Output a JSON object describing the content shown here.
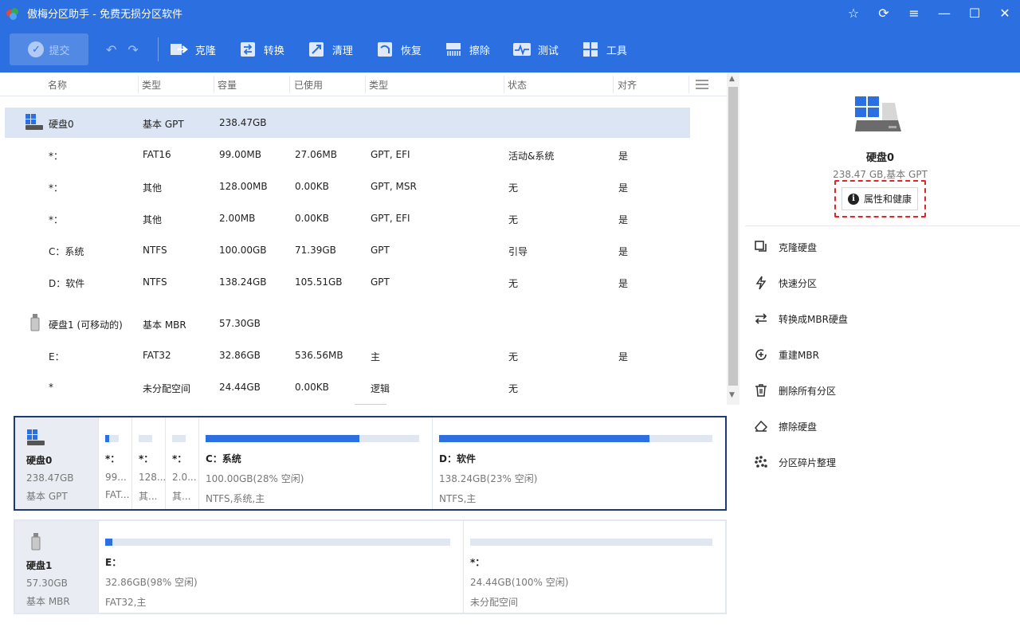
{
  "window": {
    "title": "傲梅分区助手 - 免费无损分区软件",
    "controls": [
      "star-icon",
      "refresh-icon",
      "menu-icon",
      "minimize-icon",
      "maximize-icon",
      "close-icon"
    ]
  },
  "toolbar": {
    "commit_label": "提交",
    "items": [
      {
        "label": "克隆",
        "icon": "clone-icon"
      },
      {
        "label": "转换",
        "icon": "convert-icon"
      },
      {
        "label": "清理",
        "icon": "cleanup-icon"
      },
      {
        "label": "恢复",
        "icon": "recover-icon"
      },
      {
        "label": "擦除",
        "icon": "wipe-icon"
      },
      {
        "label": "测试",
        "icon": "test-icon"
      },
      {
        "label": "工具",
        "icon": "tools-icon"
      }
    ]
  },
  "table": {
    "columns": [
      "名称",
      "类型",
      "容量",
      "已使用",
      "类型",
      "状态",
      "对齐"
    ],
    "rows": [
      {
        "name": "硬盘0",
        "type": "基本 GPT",
        "capacity": "238.47GB",
        "used": "",
        "ptype": "",
        "status": "",
        "align": "",
        "kind": "disk",
        "selected": true
      },
      {
        "name": "*：",
        "type": "FAT16",
        "capacity": "99.00MB",
        "used": "27.06MB",
        "ptype": "GPT, EFI",
        "status": "活动&系统",
        "align": "是"
      },
      {
        "name": "*：",
        "type": "其他",
        "capacity": "128.00MB",
        "used": "0.00KB",
        "ptype": "GPT, MSR",
        "status": "无",
        "align": "是"
      },
      {
        "name": "*：",
        "type": "其他",
        "capacity": "2.00MB",
        "used": "0.00KB",
        "ptype": "GPT, EFI",
        "status": "无",
        "align": "是"
      },
      {
        "name": "C：系统",
        "type": "NTFS",
        "capacity": "100.00GB",
        "used": "71.39GB",
        "ptype": "GPT",
        "status": "引导",
        "align": "是"
      },
      {
        "name": "D：软件",
        "type": "NTFS",
        "capacity": "138.24GB",
        "used": "105.51GB",
        "ptype": "GPT",
        "status": "无",
        "align": "是"
      },
      {
        "name": "硬盘1 (可移动的)",
        "type": "基本 MBR",
        "capacity": "57.30GB",
        "used": "",
        "ptype": "",
        "status": "",
        "align": "",
        "kind": "usb"
      },
      {
        "name": "E：",
        "type": "FAT32",
        "capacity": "32.86GB",
        "used": "536.56MB",
        "ptype": "主",
        "status": "无",
        "align": "是"
      },
      {
        "name": "*",
        "type": "未分配空间",
        "capacity": "24.44GB",
        "used": "0.00KB",
        "ptype": "逻辑",
        "status": "无",
        "align": ""
      }
    ]
  },
  "diskmap": {
    "disk0": {
      "name": "硬盘0",
      "size": "238.47GB",
      "kind": "基本 GPT",
      "parts": [
        {
          "name": "*：",
          "size": "99...",
          "fs": "FAT...",
          "used": 0.27
        },
        {
          "name": "*：",
          "size": "128...",
          "fs": "其...",
          "used": 0
        },
        {
          "name": "*：",
          "size": "2.0...",
          "fs": "其...",
          "used": 0
        },
        {
          "name": "C：系统",
          "size": "100.00GB(28% 空闲)",
          "fs": "NTFS,系统,主",
          "used": 0.72
        },
        {
          "name": "D：软件",
          "size": "138.24GB(23% 空闲)",
          "fs": "NTFS,主",
          "used": 0.77
        }
      ]
    },
    "disk1": {
      "name": "硬盘1",
      "size": "57.30GB",
      "kind": "基本 MBR",
      "parts": [
        {
          "name": "E：",
          "size": "32.86GB(98% 空闲)",
          "fs": "FAT32,主",
          "used": 0.02
        },
        {
          "name": "*：",
          "size": "24.44GB(100% 空闲)",
          "fs": "未分配空间",
          "used": 0
        }
      ]
    }
  },
  "right_panel": {
    "disk_name": "硬盘0",
    "disk_sub": "238.47 GB,基本 GPT",
    "properties_label": "属性和健康",
    "actions": [
      {
        "label": "克隆硬盘",
        "icon": "clone-disk-icon"
      },
      {
        "label": "快速分区",
        "icon": "lightning-icon"
      },
      {
        "label": "转换成MBR硬盘",
        "icon": "convert-arrows-icon"
      },
      {
        "label": "重建MBR",
        "icon": "rebuild-icon"
      },
      {
        "label": "删除所有分区",
        "icon": "trash-icon"
      },
      {
        "label": "擦除硬盘",
        "icon": "eraser-icon"
      },
      {
        "label": "分区碎片整理",
        "icon": "defrag-icon"
      }
    ]
  },
  "colors": {
    "accent": "#2b6fe0",
    "selected_row": "#dbe5f3",
    "highlight": "#e0262a",
    "disk_border_active": "#1d3a77"
  }
}
